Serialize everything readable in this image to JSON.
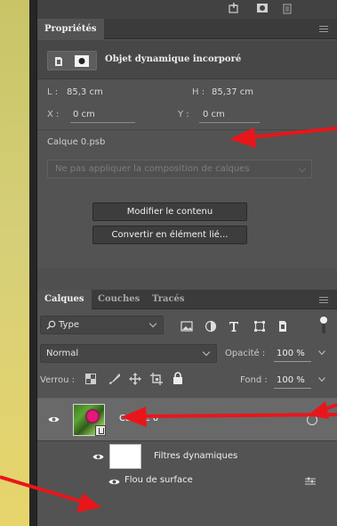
{
  "properties_panel": {
    "tab_label": "Propriétés",
    "object_type": "Objet dynamique incorporé",
    "width_label": "L :",
    "width_value": "85,3 cm",
    "height_label": "H :",
    "height_value": "85,37 cm",
    "x_label": "X :",
    "x_value": "0 cm",
    "y_label": "Y :",
    "y_value": "0 cm",
    "file_name": "Calque 0.psb",
    "layer_comp_placeholder": "Ne pas appliquer la composition de calques",
    "edit_contents_button": "Modifier le contenu",
    "convert_linked_button": "Convertir en élément lié..."
  },
  "layers_panel": {
    "tabs": [
      "Calques",
      "Couches",
      "Tracés"
    ],
    "filter_kind": "Type",
    "blend_mode": "Normal",
    "opacity_label": "Opacité :",
    "opacity_value": "100 %",
    "lock_label": "Verrou :",
    "fill_label": "Fond :",
    "fill_value": "100 %",
    "layer_name": "Calque 0",
    "smart_filters_label": "Filtres dynamiques",
    "filter_name": "Flou de surface"
  },
  "colors": {
    "panel_bg": "#535353",
    "selected_row": "#696969",
    "arrow": "#e8161b",
    "background": "#d6cf78"
  },
  "icons": {
    "top_toolbar": [
      "new-layer-icon",
      "mask-icon",
      "trash-icon"
    ],
    "filter_types": [
      "image-filter-icon",
      "adjustment-filter-icon",
      "text-filter-icon",
      "shape-filter-icon",
      "smart-object-filter-icon"
    ]
  }
}
